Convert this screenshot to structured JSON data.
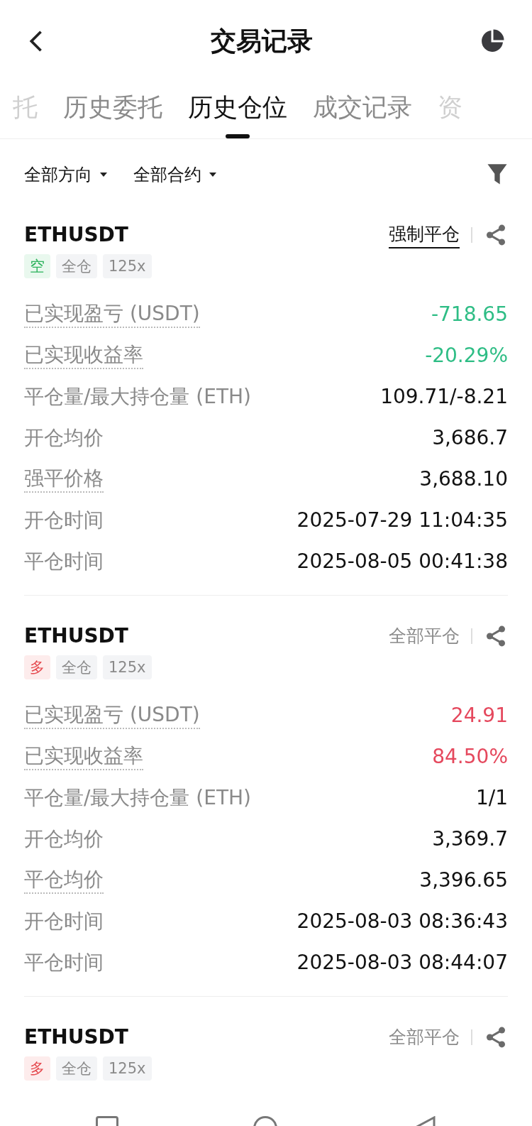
{
  "header": {
    "title": "交易记录"
  },
  "tabs": [
    {
      "label": "托",
      "selected": false,
      "partial": true
    },
    {
      "label": "历史委托",
      "selected": false,
      "partial": false
    },
    {
      "label": "历史仓位",
      "selected": true,
      "partial": false
    },
    {
      "label": "成交记录",
      "selected": false,
      "partial": false
    },
    {
      "label": "资",
      "selected": false,
      "partial": true
    }
  ],
  "filters": [
    {
      "label": "全部方向"
    },
    {
      "label": "全部合约"
    }
  ],
  "positions": [
    {
      "symbol": "ETHUSDT",
      "close_type": "强制平仓",
      "forced": true,
      "tags": [
        {
          "kind": "short",
          "label": "空"
        },
        {
          "kind": "plain",
          "label": "全仓"
        },
        {
          "kind": "plain",
          "label": "125x"
        }
      ],
      "rows": [
        {
          "label": "已实现盈亏 (USDT)",
          "hint": true,
          "value": "-718.65",
          "kind": "down"
        },
        {
          "label": "已实现收益率",
          "hint": true,
          "value": "-20.29%",
          "kind": "down"
        },
        {
          "label": "平仓量/最大持仓量 (ETH)",
          "hint": false,
          "value": "109.71/-8.21",
          "kind": "plain"
        },
        {
          "label": "开仓均价",
          "hint": false,
          "value": "3,686.7",
          "kind": "plain"
        },
        {
          "label": "强平价格",
          "hint": true,
          "value": "3,688.10",
          "kind": "plain"
        },
        {
          "label": "开仓时间",
          "hint": false,
          "value": "2025-07-29 11:04:35",
          "kind": "plain"
        },
        {
          "label": "平仓时间",
          "hint": false,
          "value": "2025-08-05 00:41:38",
          "kind": "plain"
        }
      ]
    },
    {
      "symbol": "ETHUSDT",
      "close_type": "全部平仓",
      "forced": false,
      "tags": [
        {
          "kind": "long",
          "label": "多"
        },
        {
          "kind": "plain",
          "label": "全仓"
        },
        {
          "kind": "plain",
          "label": "125x"
        }
      ],
      "rows": [
        {
          "label": "已实现盈亏 (USDT)",
          "hint": true,
          "value": "24.91",
          "kind": "up"
        },
        {
          "label": "已实现收益率",
          "hint": true,
          "value": "84.50%",
          "kind": "up"
        },
        {
          "label": "平仓量/最大持仓量 (ETH)",
          "hint": false,
          "value": "1/1",
          "kind": "plain"
        },
        {
          "label": "开仓均价",
          "hint": false,
          "value": "3,369.7",
          "kind": "plain"
        },
        {
          "label": "平仓均价",
          "hint": true,
          "value": "3,396.65",
          "kind": "plain"
        },
        {
          "label": "开仓时间",
          "hint": false,
          "value": "2025-08-03 08:36:43",
          "kind": "plain"
        },
        {
          "label": "平仓时间",
          "hint": false,
          "value": "2025-08-03 08:44:07",
          "kind": "plain"
        }
      ]
    },
    {
      "symbol": "ETHUSDT",
      "close_type": "全部平仓",
      "forced": false,
      "tags": [
        {
          "kind": "long",
          "label": "多"
        },
        {
          "kind": "plain",
          "label": "全仓"
        },
        {
          "kind": "plain",
          "label": "125x"
        }
      ]
    }
  ]
}
